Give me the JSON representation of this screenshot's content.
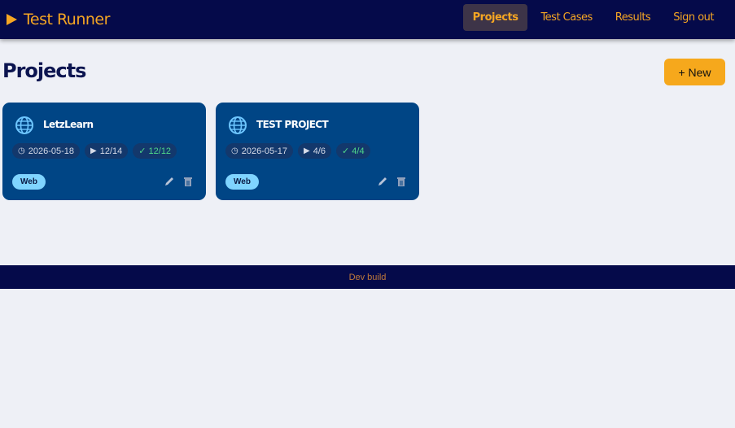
{
  "header": {
    "app_title": "Test Runner",
    "nav": [
      {
        "label": "Projects",
        "active": true
      },
      {
        "label": "Test Cases",
        "active": false
      },
      {
        "label": "Results",
        "active": false
      },
      {
        "label": "Sign out",
        "active": false
      }
    ]
  },
  "main": {
    "page_title": "Projects",
    "new_button_label": "+ New"
  },
  "projects": [
    {
      "name": "LetzLearn",
      "date": "2026-05-18",
      "runs": "12/14",
      "passed": "✓ 12/12",
      "type": "Web",
      "icon": "globe-icon"
    },
    {
      "name": "TEST PROJECT",
      "date": "2026-05-17",
      "runs": "4/6",
      "passed": "✓ 4/4",
      "type": "Web",
      "icon": "globe-icon"
    }
  ],
  "footer": {
    "text": "Dev build"
  },
  "colors": {
    "accent": "#f5a623",
    "navbar": "#050a4a",
    "card": "#004585",
    "tag": "#7fd4ff",
    "pass": "#4fd88a"
  }
}
